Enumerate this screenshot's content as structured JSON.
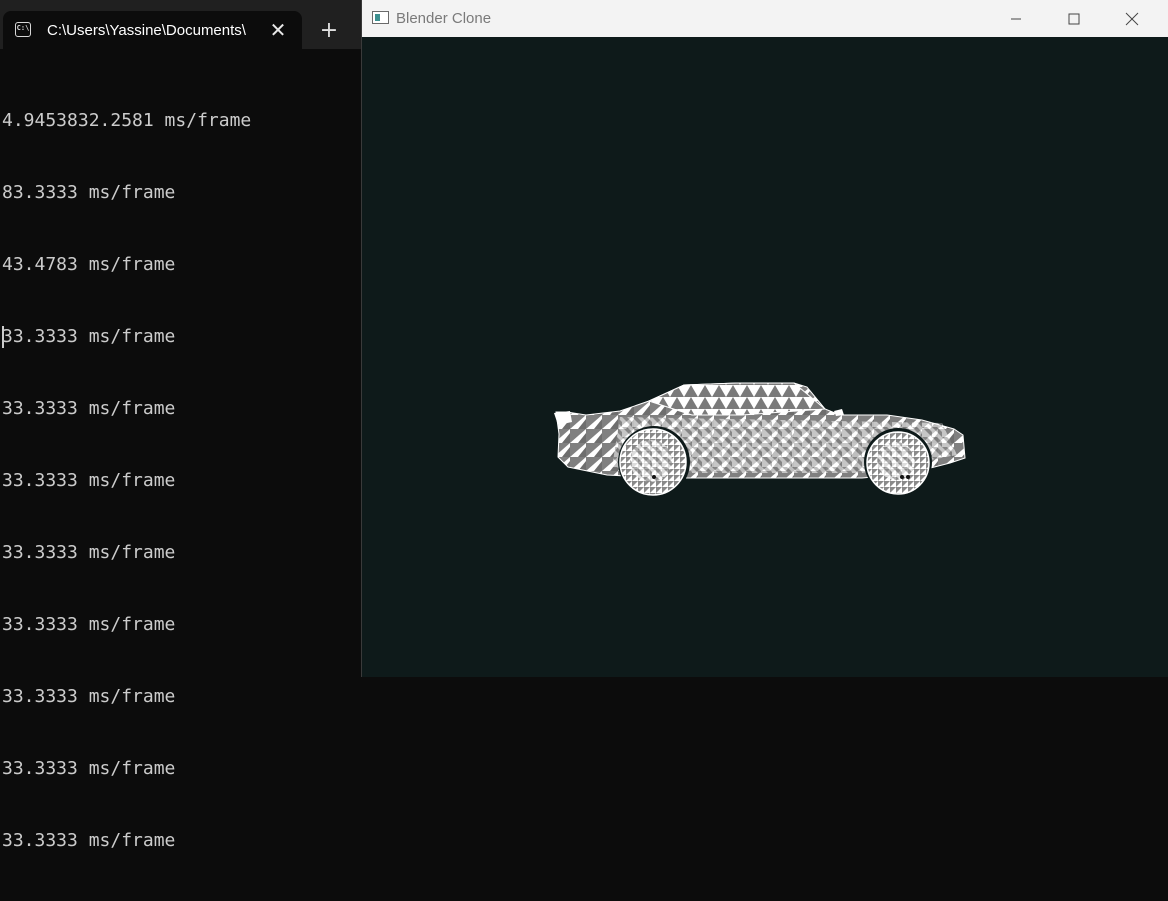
{
  "terminal": {
    "tab_title": "C:\\Users\\Yassine\\Documents\\",
    "tab_icon": "C:\\",
    "close_symbol": "✕",
    "new_tab_symbol": "+",
    "lines": [
      "4.9453832.2581 ms/frame",
      "83.3333 ms/frame",
      "43.4783 ms/frame",
      "33.3333 ms/frame",
      "33.3333 ms/frame",
      "33.3333 ms/frame",
      "33.3333 ms/frame",
      "33.3333 ms/frame",
      "33.3333 ms/frame",
      "33.3333 ms/frame",
      "33.3333 ms/frame"
    ]
  },
  "blender": {
    "window_title": "Blender Clone",
    "viewport_bg": "#0e1a1a",
    "model": "car-wireframe"
  },
  "colors": {
    "terminal_bg": "#0c0c0c",
    "terminal_tabbar": "#202020",
    "terminal_text": "#cccccc",
    "mesh_light": "#ffffff",
    "mesh_dark": "#7f7f7f"
  }
}
